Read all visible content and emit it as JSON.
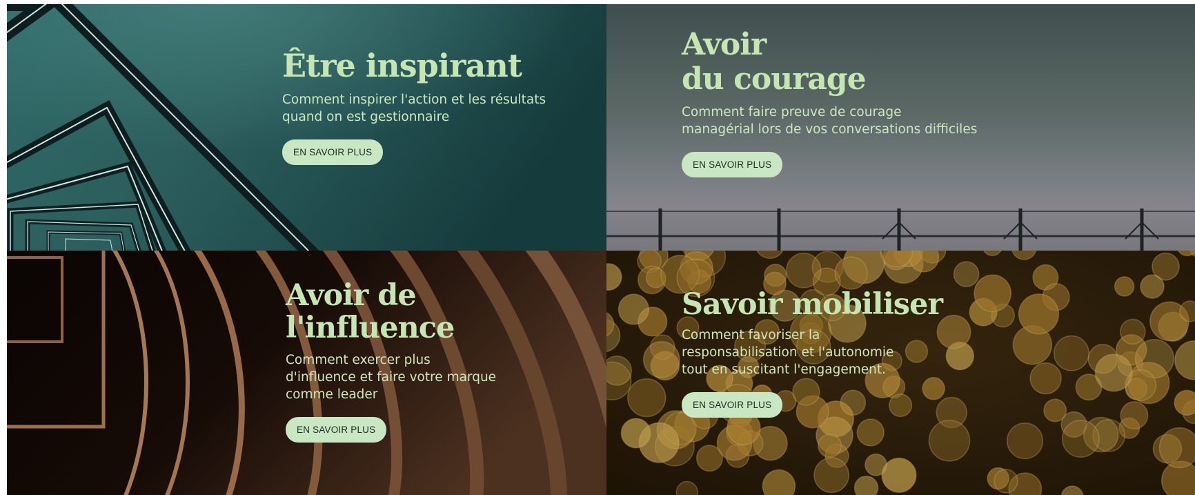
{
  "tiles": [
    {
      "title_lines": [
        "Être inspirant"
      ],
      "desc_lines": [
        "Comment inspirer l'action et les résultats",
        "quand on est gestionnaire"
      ],
      "button_label": "EN SAVOIR PLUS"
    },
    {
      "title_lines": [
        "Avoir",
        "du courage"
      ],
      "desc_lines": [
        "Comment faire preuve de courage",
        "managérial lors de vos conversations difficiles"
      ],
      "button_label": "EN SAVOIR PLUS"
    },
    {
      "title_lines": [
        "Avoir de",
        "l'influence"
      ],
      "desc_lines": [
        "Comment exercer plus",
        "d'influence et faire votre marque",
        "comme leader"
      ],
      "button_label": "EN SAVOIR PLUS"
    },
    {
      "title_lines": [
        "Savoir mobiliser"
      ],
      "desc_lines": [
        "Comment favoriser la",
        "responsabilisation et l'autonomie",
        "tout en suscitant l'engagement."
      ],
      "button_label": "EN SAVOIR PLUS"
    }
  ],
  "colors": {
    "title": "#c5e6b2",
    "text": "#cde8bd",
    "button_bg": "#c8e7c2",
    "button_text": "#1e2a22"
  }
}
